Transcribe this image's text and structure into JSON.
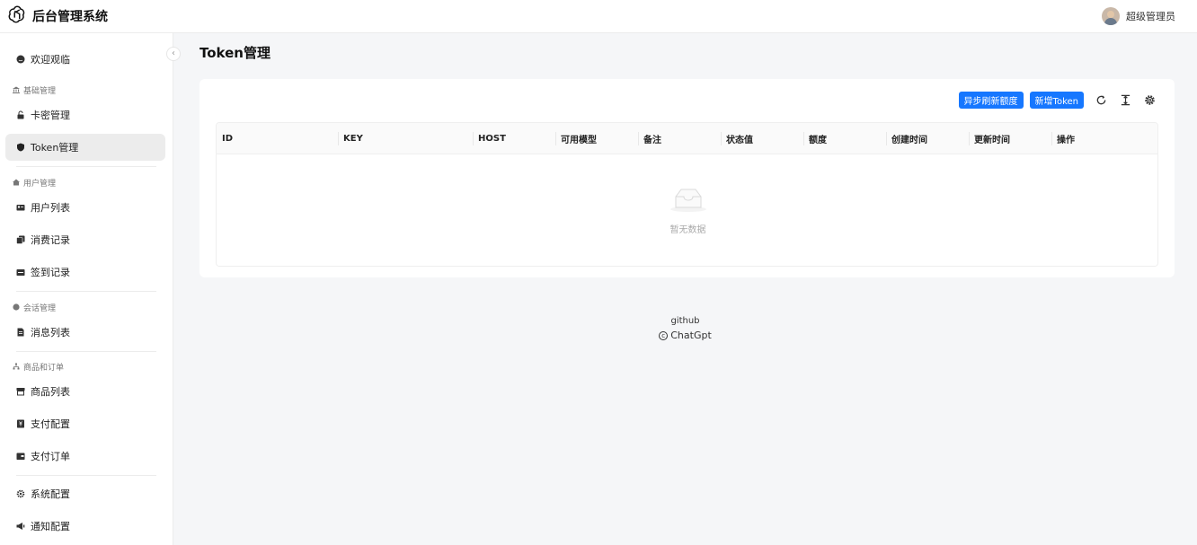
{
  "app": {
    "title": "后台管理系统"
  },
  "user": {
    "name": "超级管理员"
  },
  "sidebar": {
    "welcome": "欢迎观临",
    "groups": [
      {
        "label": "基础管理",
        "items": [
          "卡密管理",
          "Token管理"
        ]
      },
      {
        "label": "用户管理",
        "items": [
          "用户列表",
          "消费记录",
          "签到记录"
        ]
      },
      {
        "label": "会话管理",
        "items": [
          "消息列表"
        ]
      },
      {
        "label": "商品和订单",
        "items": [
          "商品列表",
          "支付配置",
          "支付订单"
        ]
      }
    ],
    "bottom": [
      "系统配置",
      "通知配置"
    ],
    "active": "Token管理"
  },
  "page": {
    "title": "Token管理"
  },
  "toolbar": {
    "refresh_quota_label": "异步刷新额度",
    "add_token_label": "新增Token"
  },
  "table": {
    "columns": [
      "ID",
      "KEY",
      "HOST",
      "可用模型",
      "备注",
      "状态值",
      "额度",
      "创建时间",
      "更新时间",
      "操作"
    ],
    "rows": [],
    "empty_text": "暂无数据"
  },
  "footer": {
    "link": "github",
    "copyright": "ChatGpt"
  },
  "colors": {
    "primary": "#1677ff",
    "active_bg": "#ececec"
  }
}
